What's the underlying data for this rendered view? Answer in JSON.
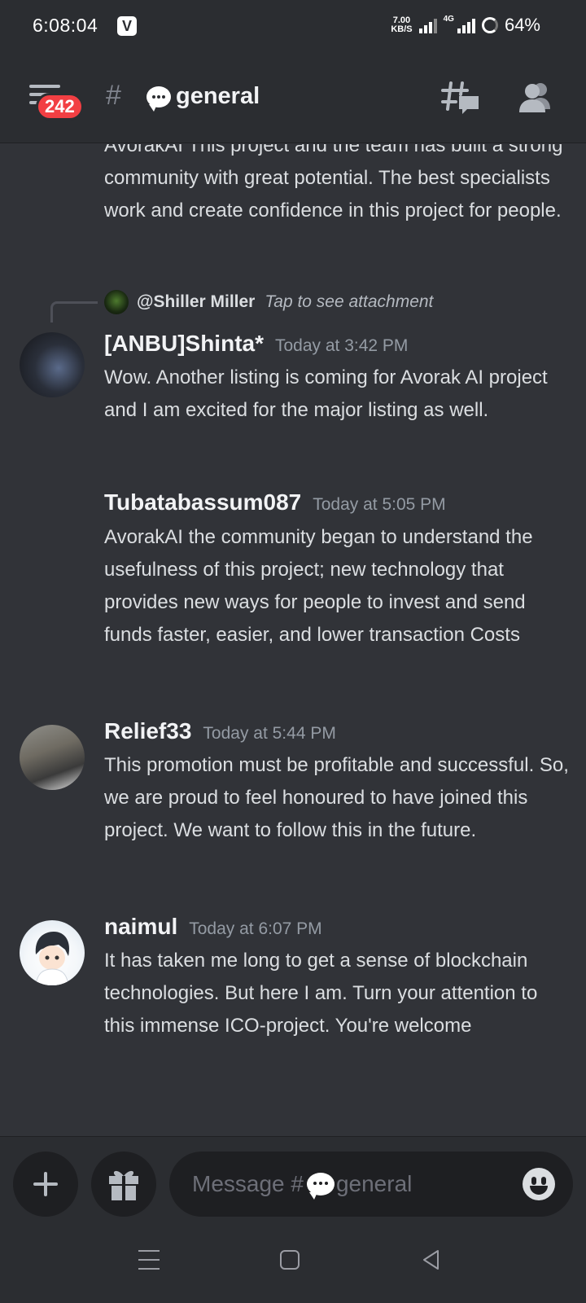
{
  "status_bar": {
    "time": "6:08:04",
    "net_speed_value": "7.00",
    "net_speed_unit": "KB/S",
    "network_type": "4G",
    "battery": "64%"
  },
  "header": {
    "unread_badge": "242",
    "channel_name": "general",
    "channel_emoji": "speech-bubble"
  },
  "messages": [
    {
      "id": "m0",
      "continued": true,
      "text": "AvorakAI This project and the team has built a strong community with great potential. The best specialists work and create confidence in this project for people."
    },
    {
      "id": "m1",
      "reply": {
        "name": "@Shiller Miller",
        "hint": "Tap to see attachment"
      },
      "author": "[ANBU]Shinta*",
      "timestamp": "Today at 3:42 PM",
      "text": "Wow. Another listing is coming for Avorak AI project and I am excited for the major listing as well."
    },
    {
      "id": "m2",
      "author": "Tubatabassum087",
      "timestamp": "Today at 5:05 PM",
      "text": "AvorakAI the community began to understand the usefulness of this project; new technology that provides new ways for people to invest and send funds faster, easier, and lower transaction Costs"
    },
    {
      "id": "m3",
      "author": "Relief33",
      "timestamp": "Today at 5:44 PM",
      "text": "This promotion must be profitable and successful. So, we are proud to feel honoured to have joined this project. We want to follow this in the future."
    },
    {
      "id": "m4",
      "author": "naimul",
      "timestamp": "Today at 6:07 PM",
      "text": "It has taken me long to get a sense of blockchain technologies. But here I am. Turn your attention to this immense ICO-project. You're welcome"
    }
  ],
  "composer": {
    "placeholder_prefix": "Message #",
    "placeholder_channel": "general"
  },
  "colors": {
    "background": "#313338",
    "header": "#2b2d31",
    "badge": "#f23f43",
    "text": "#dbdee1",
    "muted": "#949ba4"
  }
}
